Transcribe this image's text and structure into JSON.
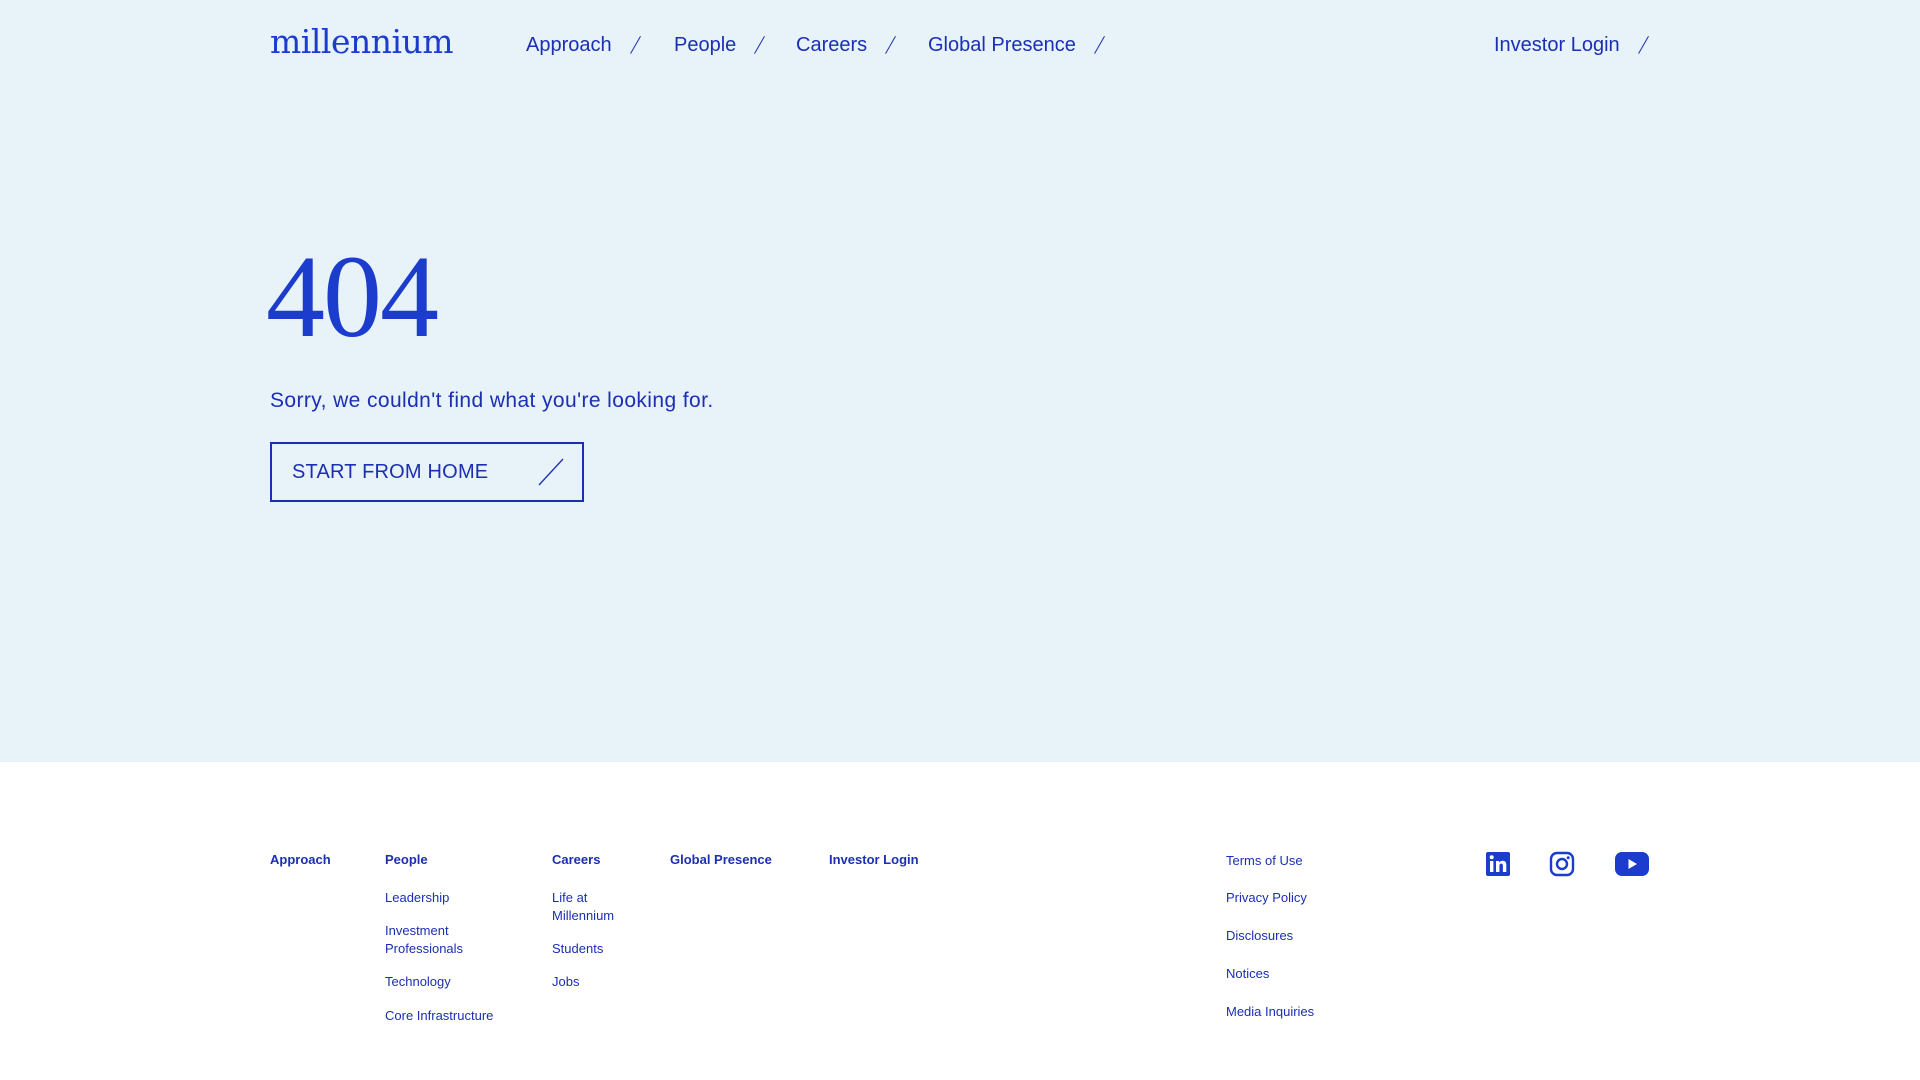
{
  "header": {
    "logo": "millennium",
    "nav": [
      {
        "label": "Approach"
      },
      {
        "label": "People"
      },
      {
        "label": "Careers"
      },
      {
        "label": "Global Presence"
      }
    ],
    "investor_login": "Investor Login"
  },
  "error": {
    "code": "404",
    "message": "Sorry, we couldn't find what you're looking for.",
    "button_label": "START FROM HOME"
  },
  "footer": {
    "columns": [
      {
        "heading": "Approach",
        "links": []
      },
      {
        "heading": "People",
        "links": [
          "Leadership",
          "Investment Professionals",
          "Technology",
          "Core Infrastructure"
        ]
      },
      {
        "heading": "Careers",
        "links": [
          "Life at Millennium",
          "Students",
          "Jobs"
        ]
      },
      {
        "heading": "Global Presence",
        "links": []
      },
      {
        "heading": "Investor Login",
        "links": []
      }
    ],
    "legal": [
      "Terms of Use",
      "Privacy Policy",
      "Disclosures",
      "Notices",
      "Media Inquiries"
    ],
    "social": [
      "linkedin-icon",
      "instagram-icon",
      "youtube-icon"
    ]
  },
  "colors": {
    "brand_blue": "#1b3ccc",
    "text_blue": "#1b2fb3",
    "hero_background": "#e8f2f9",
    "footer_background": "#ffffff"
  }
}
